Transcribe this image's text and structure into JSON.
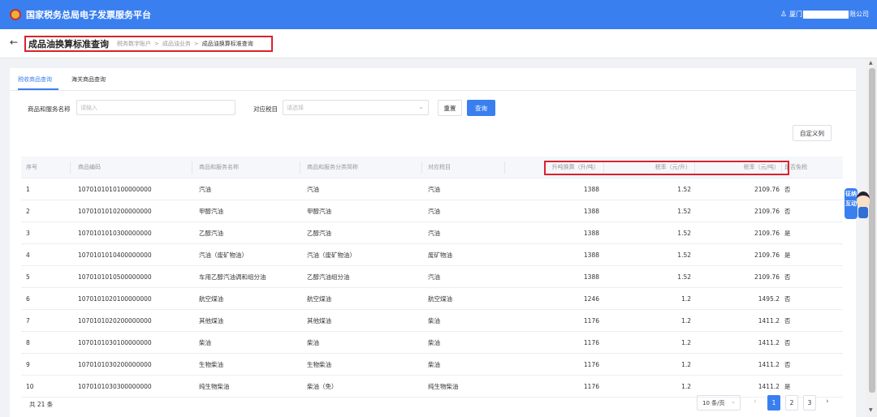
{
  "header": {
    "app_title": "国家税务总局电子发票服务平台",
    "user_prefix": "厦门",
    "user_suffix": "限公司"
  },
  "titlebar": {
    "page_title": "成品油换算标准查询",
    "breadcrumb": [
      "税务数字账户",
      "成品油业务",
      "成品油换算标准查询"
    ],
    "breadcrumb_sep": ">"
  },
  "tabs": [
    {
      "label": "税收商品查询",
      "active": true
    },
    {
      "label": "海关商品查询",
      "active": false
    }
  ],
  "filters": {
    "name_label": "商品和服务名称",
    "name_placeholder": "请输入",
    "tax_item_label": "对应税目",
    "tax_item_placeholder": "请选择"
  },
  "buttons": {
    "reset": "重置",
    "search": "查询",
    "custom_columns": "自定义列"
  },
  "table": {
    "columns": [
      "序号",
      "商品编码",
      "商品和服务名称",
      "商品和服务分类简称",
      "对应税目",
      "升吨换算（升/吨）",
      "税率（元/升）",
      "税率（元/吨）",
      "是否免税"
    ],
    "rows": [
      [
        "1",
        "1070101010100000000",
        "汽油",
        "汽油",
        "汽油",
        "1388",
        "1.52",
        "2109.76",
        "否"
      ],
      [
        "2",
        "1070101010200000000",
        "甲醇汽油",
        "甲醇汽油",
        "汽油",
        "1388",
        "1.52",
        "2109.76",
        "否"
      ],
      [
        "3",
        "1070101010300000000",
        "乙醇汽油",
        "乙醇汽油",
        "汽油",
        "1388",
        "1.52",
        "2109.76",
        "是"
      ],
      [
        "4",
        "1070101010400000000",
        "汽油（废矿物油）",
        "汽油（废矿物油）",
        "废矿物油",
        "1388",
        "1.52",
        "2109.76",
        "是"
      ],
      [
        "5",
        "1070101010500000000",
        "车用乙醇汽油调和组分油",
        "乙醇汽油组分油",
        "汽油",
        "1388",
        "1.52",
        "2109.76",
        "否"
      ],
      [
        "6",
        "1070101020100000000",
        "航空煤油",
        "航空煤油",
        "航空煤油",
        "1246",
        "1.2",
        "1495.2",
        "否"
      ],
      [
        "7",
        "1070101020200000000",
        "其他煤油",
        "其他煤油",
        "柴油",
        "1176",
        "1.2",
        "1411.2",
        "否"
      ],
      [
        "8",
        "1070101030100000000",
        "柴油",
        "柴油",
        "柴油",
        "1176",
        "1.2",
        "1411.2",
        "否"
      ],
      [
        "9",
        "1070101030200000000",
        "生物柴油",
        "生物柴油",
        "柴油",
        "1176",
        "1.2",
        "1411.2",
        "否"
      ],
      [
        "10",
        "1070101030300000000",
        "纯生物柴油",
        "柴油（免）",
        "纯生物柴油",
        "1176",
        "1.2",
        "1411.2",
        "是"
      ]
    ]
  },
  "pagination": {
    "total": "共 21 条",
    "page_size": "10 条/页",
    "pages": [
      "1",
      "2",
      "3"
    ],
    "current": "1"
  },
  "helper": {
    "text": "征纳互动"
  },
  "colors": {
    "primary": "#3a7ff0",
    "highlight": "#d9232e"
  }
}
